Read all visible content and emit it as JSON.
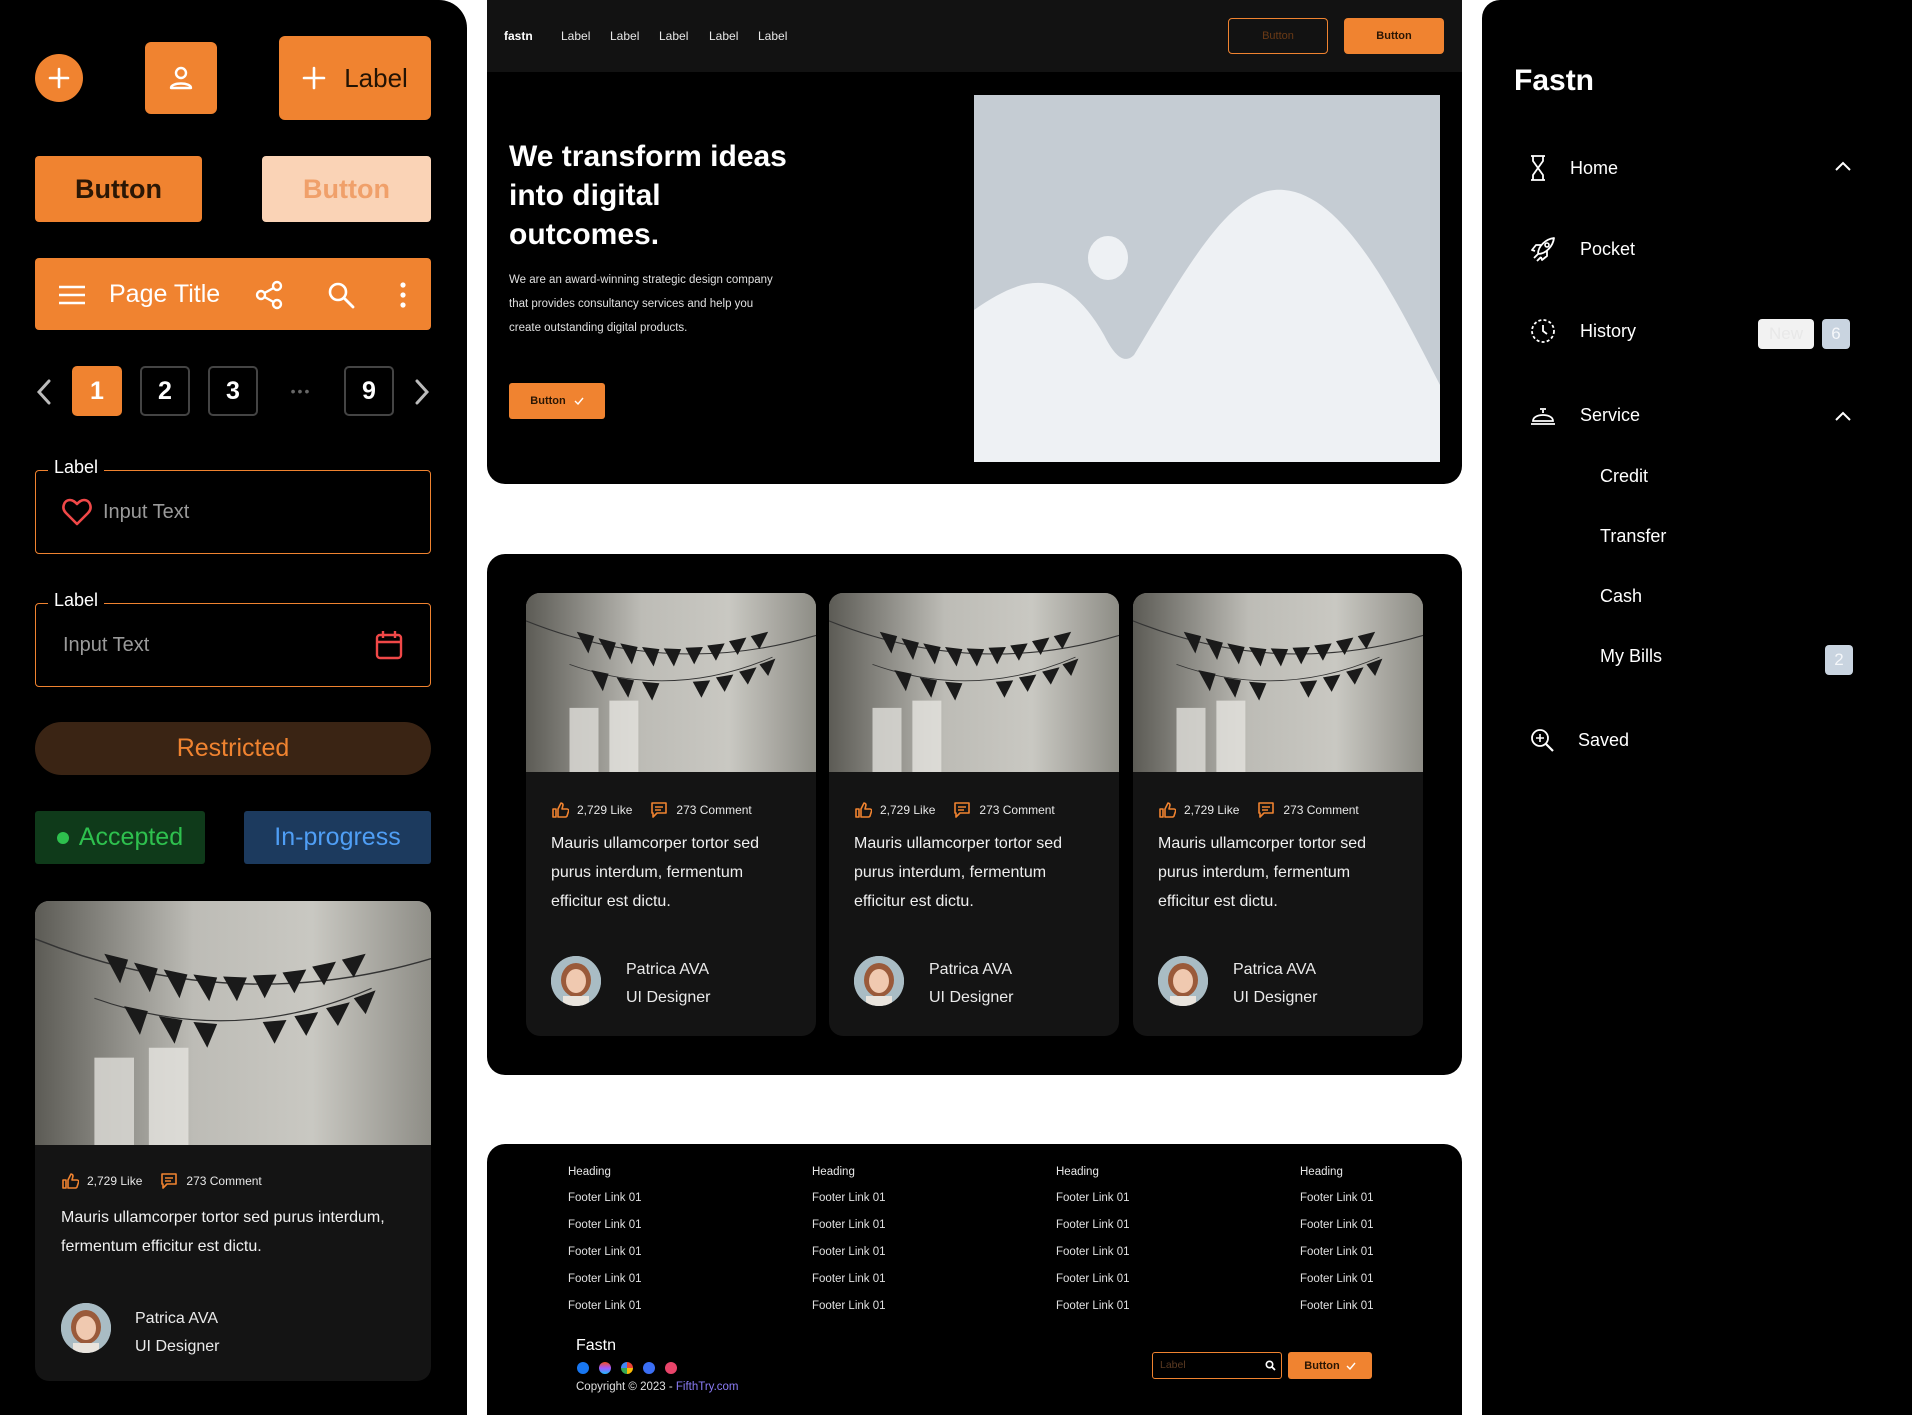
{
  "left": {
    "label_button": "Label",
    "primary_button": "Button",
    "light_button": "Button",
    "appbar_title": "Page Title",
    "pagination": [
      "1",
      "2",
      "3",
      "9"
    ],
    "pagination_ellipsis": "•••",
    "field1": {
      "label": "Label",
      "value": "Input Text"
    },
    "field2": {
      "label": "Label",
      "value": "Input Text"
    },
    "restricted": "Restricted",
    "accepted": "Accepted",
    "in_progress": "In-progress",
    "card": {
      "likes": "2,729 Like",
      "comments": "273 Comment",
      "desc": "Mauris ullamcorper tortor sed purus interdum, fermentum efficitur est dictu.",
      "author": "Patrica AVA",
      "role": "UI Designer"
    }
  },
  "hero": {
    "logo": "fastn",
    "nav": [
      "Label",
      "Label",
      "Label",
      "Label",
      "Label"
    ],
    "outline_button": "Button",
    "solid_button": "Button",
    "heading": "We transform ideas into digital outcomes.",
    "paragraph": "We are an award-winning strategic design company that provides consultancy services and help you create outstanding digital products.",
    "cta": "Button"
  },
  "cards": [
    {
      "likes": "2,729 Like",
      "comments": "273 Comment",
      "desc": "Mauris ullamcorper tortor sed purus interdum, fermentum efficitur est dictu.",
      "author": "Patrica AVA",
      "role": "UI Designer"
    },
    {
      "likes": "2,729 Like",
      "comments": "273 Comment",
      "desc": "Mauris ullamcorper tortor sed purus interdum, fermentum efficitur est dictu.",
      "author": "Patrica AVA",
      "role": "UI Designer"
    },
    {
      "likes": "2,729 Like",
      "comments": "273 Comment",
      "desc": "Mauris ullamcorper tortor sed purus interdum, fermentum efficitur est dictu.",
      "author": "Patrica AVA",
      "role": "UI Designer"
    }
  ],
  "footer": {
    "columns": [
      {
        "heading": "Heading",
        "links": [
          "Footer Link 01",
          "Footer Link 01",
          "Footer Link 01",
          "Footer Link 01",
          "Footer Link 01"
        ]
      },
      {
        "heading": "Heading",
        "links": [
          "Footer Link 01",
          "Footer Link 01",
          "Footer Link 01",
          "Footer Link 01",
          "Footer Link 01"
        ]
      },
      {
        "heading": "Heading",
        "links": [
          "Footer Link 01",
          "Footer Link 01",
          "Footer Link 01",
          "Footer Link 01",
          "Footer Link 01"
        ]
      },
      {
        "heading": "Heading",
        "links": [
          "Footer Link 01",
          "Footer Link 01",
          "Footer Link 01",
          "Footer Link 01",
          "Footer Link 01"
        ]
      }
    ],
    "logo": "Fastn",
    "copyright": "Copyright © 2023 - ",
    "copyright_link": "FifthTry.com",
    "input_placeholder": "Label",
    "button": "Button"
  },
  "side": {
    "logo": "Fastn",
    "items": {
      "home": "Home",
      "pocket": "Pocket",
      "history": "History",
      "history_new": "New",
      "history_count": "6",
      "service": "Service",
      "credit": "Credit",
      "transfer": "Transfer",
      "cash": "Cash",
      "my_bills": "My Bills",
      "my_bills_count": "2",
      "saved": "Saved"
    }
  },
  "colors": {
    "accent": "#F08330",
    "panel": "#000000",
    "card": "#141414",
    "success": "#2ec04e",
    "info": "#4f9ef5"
  }
}
